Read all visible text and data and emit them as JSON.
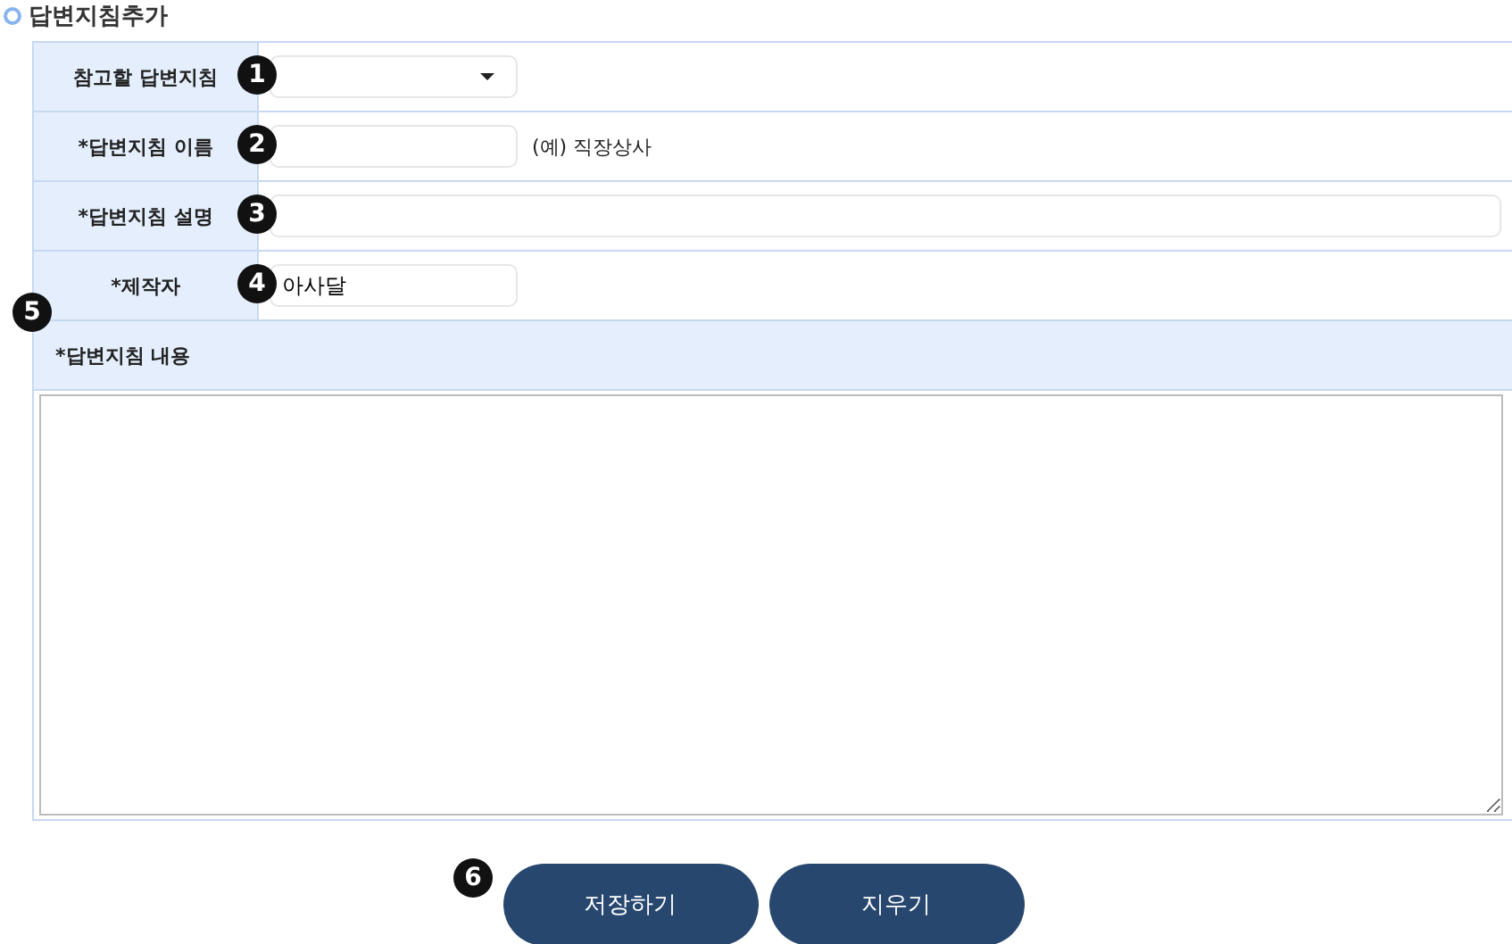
{
  "title": "답변지침추가",
  "fields": [
    {
      "kind": "select",
      "label": "참고할 답변지침",
      "badge": "1"
    },
    {
      "kind": "short",
      "label": "*답변지침 이름",
      "badge": "2",
      "hint": "(예) 직장상사"
    },
    {
      "kind": "long",
      "label": "*답변지침 설명",
      "badge": "3"
    },
    {
      "kind": "short",
      "label": "*제작자",
      "badge": "4",
      "value": "아사달"
    }
  ],
  "content": {
    "label": "*답변지침 내용",
    "badge": "5"
  },
  "buttons_badge": "6",
  "buttons": [
    "저장하기",
    "지우기"
  ]
}
